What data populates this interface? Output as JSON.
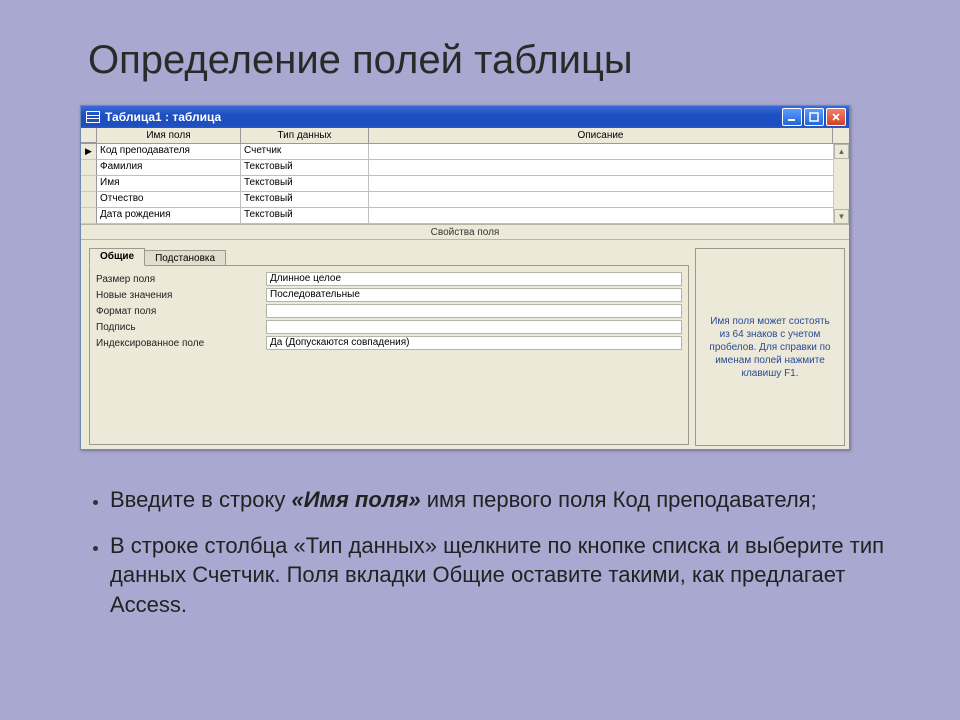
{
  "slide": {
    "title": "Определение полей таблицы",
    "bullet1_prefix": "Введите в строку ",
    "bullet1_em": "«Имя поля»",
    "bullet1_suffix": " имя первого поля Код преподавателя;",
    "bullet2": "В строке столбца «Тип данных» щелкните по кнопке списка и выберите тип данных Счетчик. Поля вкладки Общие оставите такими, как предлагает Access."
  },
  "window": {
    "title": "Таблица1 : таблица",
    "columns": {
      "name": "Имя поля",
      "type": "Тип данных",
      "desc": "Описание"
    },
    "rows": [
      {
        "name": "Код преподавателя",
        "type": "Счетчик",
        "desc": "",
        "current": true
      },
      {
        "name": "Фамилия",
        "type": "Текстовый",
        "desc": ""
      },
      {
        "name": "Имя",
        "type": "Текстовый",
        "desc": ""
      },
      {
        "name": "Отчество",
        "type": "Текстовый",
        "desc": ""
      },
      {
        "name": "Дата рождения",
        "type": "Текстовый",
        "desc": ""
      }
    ],
    "props_header": "Свойства поля",
    "tabs": {
      "general": "Общие",
      "lookup": "Подстановка"
    },
    "properties": [
      {
        "label": "Размер поля",
        "value": "Длинное целое"
      },
      {
        "label": "Новые значения",
        "value": "Последовательные"
      },
      {
        "label": "Формат поля",
        "value": ""
      },
      {
        "label": "Подпись",
        "value": ""
      },
      {
        "label": "Индексированное поле",
        "value": "Да (Допускаются совпадения)"
      }
    ],
    "help": "Имя поля может состоять из 64 знаков с учетом пробелов. Для справки по именам полей нажмите клавишу F1."
  }
}
